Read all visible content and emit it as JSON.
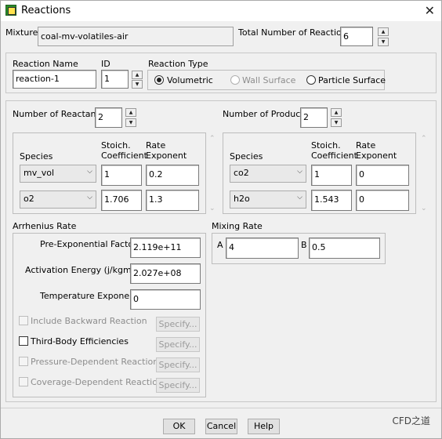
{
  "window": {
    "title": "Reactions"
  },
  "mixture": {
    "label": "Mixture",
    "value": "coal-mv-volatiles-air"
  },
  "total_reactions": {
    "label": "Total Number of Reactions",
    "value": "6"
  },
  "reaction": {
    "name_label": "Reaction Name",
    "name_value": "reaction-1",
    "id_label": "ID",
    "id_value": "1",
    "type_label": "Reaction Type",
    "types": {
      "volumetric": "Volumetric",
      "wall_surface": "Wall Surface",
      "particle_surface": "Particle Surface"
    },
    "selected_type": "Volumetric"
  },
  "reactants": {
    "count_label": "Number of Reactants",
    "count": "2",
    "species_header": "Species",
    "coeff_header_1": "Stoich.",
    "coeff_header_2": "Coefficient",
    "rate_header_1": "Rate",
    "rate_header_2": "Exponent",
    "rows": [
      {
        "species": "mv_vol",
        "coeff": "1",
        "rate": "0.2"
      },
      {
        "species": "o2",
        "coeff": "1.706",
        "rate": "1.3"
      }
    ]
  },
  "products": {
    "count_label": "Number of Products",
    "count": "2",
    "species_header": "Species",
    "coeff_header_1": "Stoich.",
    "coeff_header_2": "Coefficient",
    "rate_header_1": "Rate",
    "rate_header_2": "Exponent",
    "rows": [
      {
        "species": "co2",
        "coeff": "1",
        "rate": "0"
      },
      {
        "species": "h2o",
        "coeff": "1.543",
        "rate": "0"
      }
    ]
  },
  "arrhenius": {
    "label": "Arrhenius Rate",
    "pre_exp_label": "Pre-Exponential Factor",
    "pre_exp_value": "2.119e+11",
    "act_energy_label": "Activation Energy (j/kgmol)",
    "act_energy_value": "2.027e+08",
    "temp_exp_label": "Temperature Exponent",
    "temp_exp_value": "0",
    "include_backward": "Include Backward Reaction",
    "third_body": "Third-Body Efficiencies",
    "pressure_dependent": "Pressure-Dependent Reaction",
    "coverage_dependent": "Coverage-Dependent Reaction",
    "specify": "Specify..."
  },
  "mixing": {
    "label": "Mixing Rate",
    "a_label": "A",
    "a_value": "4",
    "b_label": "B",
    "b_value": "0.5"
  },
  "buttons": {
    "ok": "OK",
    "cancel": "Cancel",
    "help": "Help"
  },
  "watermark": "CFD之道"
}
